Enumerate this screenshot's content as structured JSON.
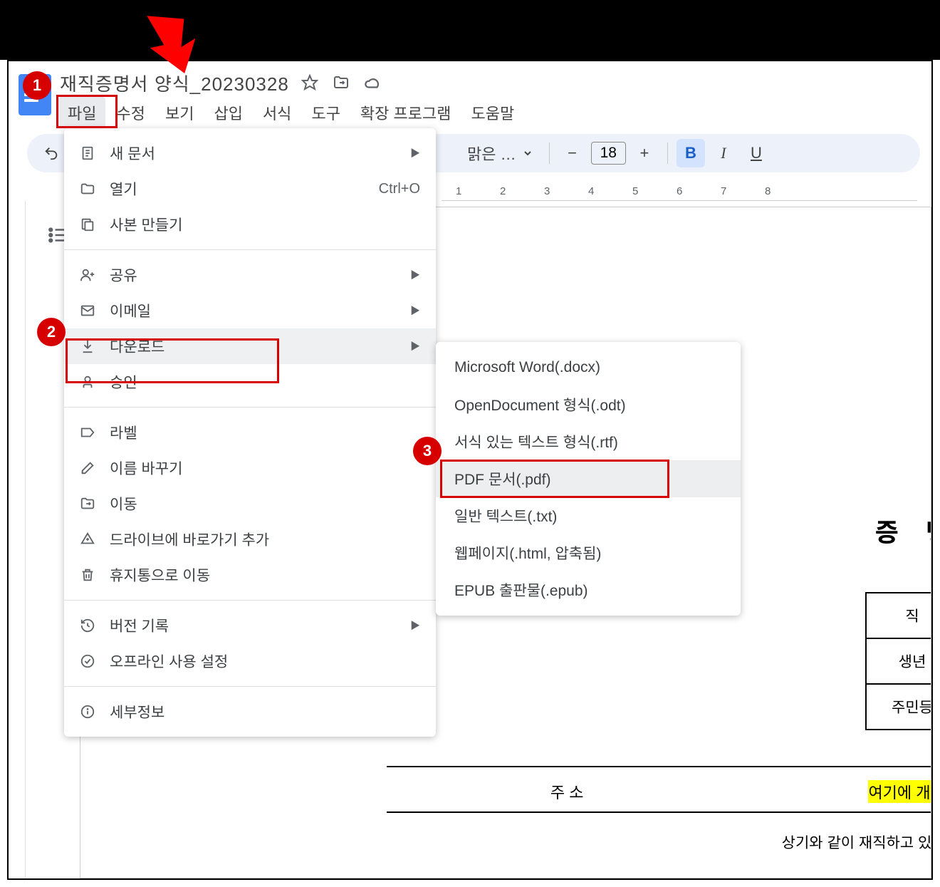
{
  "header": {
    "doc_title": "재직증명서 양식_20230328"
  },
  "menu_bar": {
    "items": [
      "파일",
      "수정",
      "보기",
      "삽입",
      "서식",
      "도구",
      "확장 프로그램",
      "도움말"
    ]
  },
  "toolbar": {
    "font_label": "맑은 …",
    "font_size": "18"
  },
  "ruler": {
    "ticks": [
      "1",
      "2",
      "3",
      "4",
      "5",
      "6",
      "7",
      "8"
    ]
  },
  "file_menu": {
    "new_doc": "새 문서",
    "open": "열기",
    "open_shortcut": "Ctrl+O",
    "make_copy": "사본 만들기",
    "share": "공유",
    "email": "이메일",
    "download": "다운로드",
    "approval": "승인",
    "label": "라벨",
    "rename": "이름 바꾸기",
    "move": "이동",
    "add_shortcut": "드라이브에 바로가기 추가",
    "trash": "휴지통으로 이동",
    "version_history": "버전 기록",
    "offline": "오프라인 사용 설정",
    "details": "세부정보"
  },
  "download_submenu": {
    "docx": "Microsoft Word(.docx)",
    "odt": "OpenDocument 형식(.odt)",
    "rtf": "서식 있는 텍스트 형식(.rtf)",
    "pdf": "PDF 문서(.pdf)",
    "txt": "일반 텍스트(.txt)",
    "html": "웹페이지(.html, 압축됨)",
    "epub": "EPUB 출판물(.epub)"
  },
  "document": {
    "heading": "증 명",
    "table": {
      "cell1": "직",
      "cell2": "생년",
      "cell3": "주민등"
    },
    "address_label": "주 소",
    "address_value": "여기에 개인의",
    "footer": "상기와 같이 재직하고 있음을"
  },
  "badges": {
    "b1": "1",
    "b2": "2",
    "b3": "3"
  }
}
